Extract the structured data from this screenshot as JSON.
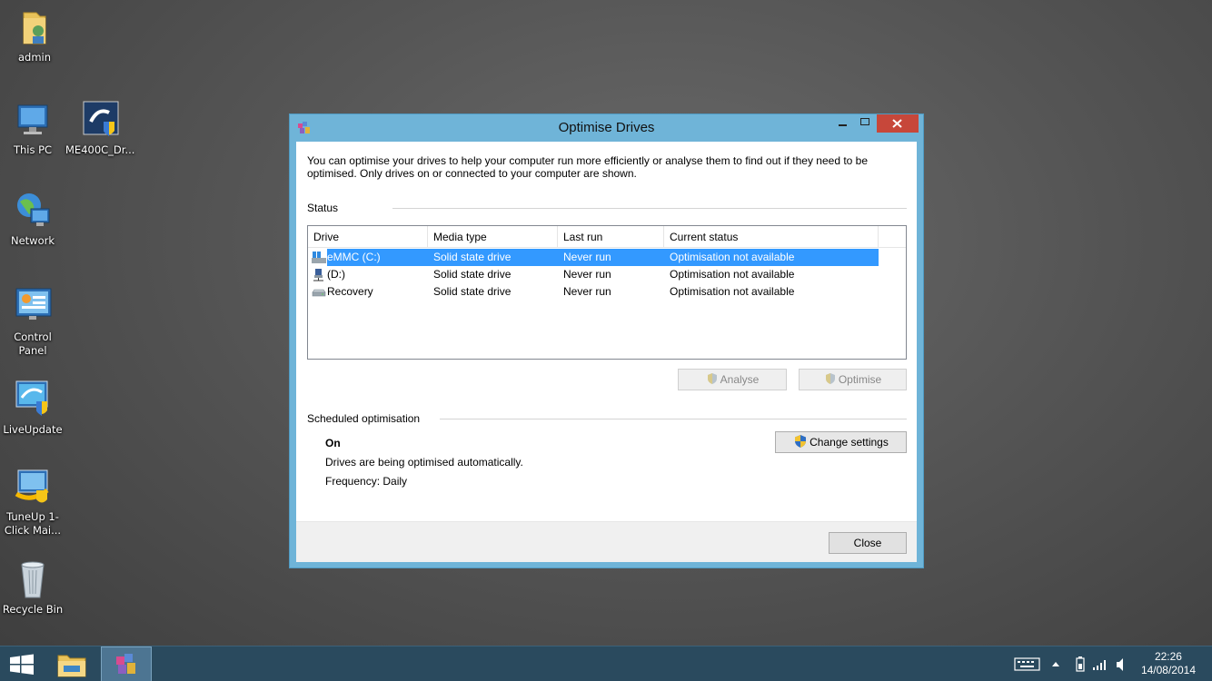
{
  "desktop": {
    "icons": [
      {
        "label": "admin",
        "icon": "user-folder-icon"
      },
      {
        "label": "This PC",
        "icon": "computer-icon"
      },
      {
        "label": "ME400C_Dr...",
        "icon": "shortcut-shield-icon"
      },
      {
        "label": "Network",
        "icon": "network-globe-icon"
      },
      {
        "label": "Control Panel",
        "icon": "control-panel-icon"
      },
      {
        "label": "LiveUpdate",
        "icon": "liveupdate-icon"
      },
      {
        "label": "TuneUp 1-Click Mai...",
        "icon": "tuneup-icon"
      },
      {
        "label": "Recycle Bin",
        "icon": "recycle-bin-icon"
      }
    ]
  },
  "window": {
    "title": "Optimise Drives",
    "intro": "You can optimise your drives to help your computer run more efficiently or analyse them to find out if they need to be optimised. Only drives on or connected to your computer are shown.",
    "status_label": "Status",
    "columns": [
      "Drive",
      "Media type",
      "Last run",
      "Current status"
    ],
    "drives": [
      {
        "drive": "eMMC (C:)",
        "media": "Solid state drive",
        "last_run": "Never run",
        "status": "Optimisation not available",
        "icon": "windows-drive-icon",
        "selected": true
      },
      {
        "drive": "(D:)",
        "media": "Solid state drive",
        "last_run": "Never run",
        "status": "Optimisation not available",
        "icon": "network-drive-icon",
        "selected": false
      },
      {
        "drive": "Recovery",
        "media": "Solid state drive",
        "last_run": "Never run",
        "status": "Optimisation not available",
        "icon": "hard-drive-icon",
        "selected": false
      }
    ],
    "analyse_label": "Analyse",
    "optimise_label": "Optimise",
    "scheduled_label": "Scheduled optimisation",
    "schedule_state": "On",
    "schedule_desc": "Drives are being optimised automatically.",
    "frequency": "Frequency: Daily",
    "change_settings_label": "Change settings",
    "close_label": "Close"
  },
  "taskbar": {
    "time": "22:26",
    "date": "14/08/2014"
  },
  "colors": {
    "window_frame": "#6fb4d8",
    "selection": "#3399ff",
    "close_button": "#c7473a",
    "taskbar": "#2a4a5e"
  }
}
